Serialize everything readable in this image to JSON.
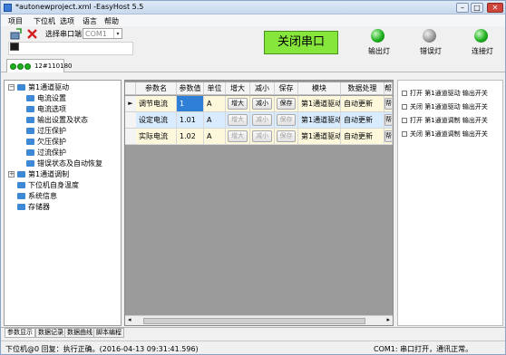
{
  "window": {
    "title": "*autonewproject.xml -EasyHost 5.5"
  },
  "menu": [
    "项目",
    "下位机",
    "选项",
    "语言",
    "帮助"
  ],
  "toolbar": {
    "port_label": "选择串口端口",
    "port_value": "COM1",
    "main_button": "关闭串口"
  },
  "lamps": [
    {
      "label": "输出灯",
      "color": "green"
    },
    {
      "label": "错误灯",
      "color": "gray"
    },
    {
      "label": "连接灯",
      "color": "green"
    }
  ],
  "device_tab": {
    "label": "12#110180"
  },
  "tree": [
    {
      "label": "第1通道驱动",
      "level": 0,
      "expanded": true
    },
    {
      "label": "电流设置",
      "level": 1
    },
    {
      "label": "电流选项",
      "level": 1
    },
    {
      "label": "输出设置及状态",
      "level": 1
    },
    {
      "label": "过压保护",
      "level": 1
    },
    {
      "label": "欠压保护",
      "level": 1
    },
    {
      "label": "过流保护",
      "level": 1
    },
    {
      "label": "错误状态及自动恢复",
      "level": 1
    },
    {
      "label": "第1通道调制",
      "level": 0,
      "expanded": false
    },
    {
      "label": "下位机自身温度",
      "level": 0
    },
    {
      "label": "系统信息",
      "level": 0
    },
    {
      "label": "存储器",
      "level": 0
    }
  ],
  "table": {
    "columns": [
      "参数名",
      "参数值",
      "单位",
      "增大",
      "减小",
      "保存",
      "模块",
      "数据处理",
      "帮"
    ],
    "rows": [
      {
        "name": "调节电流",
        "value": "1",
        "unit": "A",
        "inc": "增大",
        "dec": "减小",
        "save": "保存",
        "module": "第1通道驱动",
        "proc": "自动更新",
        "help": "帮",
        "enabled": true
      },
      {
        "name": "设定电流",
        "value": "1.01",
        "unit": "A",
        "inc": "增大",
        "dec": "减小",
        "save": "保存",
        "module": "第1通道驱动",
        "proc": "自动更新",
        "help": "帮",
        "enabled": false
      },
      {
        "name": "实际电流",
        "value": "1.02",
        "unit": "A",
        "inc": "增大",
        "dec": "减小",
        "save": "保存",
        "module": "第1通道驱动",
        "proc": "自动更新",
        "help": "帮",
        "enabled": false
      }
    ]
  },
  "right_list": [
    "打开 第1通道驱动 输出开关",
    "关闭 第1通道驱动 输出开关",
    "打开 第1通道调制 输出开关",
    "关闭 第1通道调制 输出开关"
  ],
  "bottom_tabs": [
    "参数显示",
    "数据记录",
    "数据曲线",
    "脚本编程"
  ],
  "status": {
    "left": "下位机@0 回复：执行正确。(2016-04-13 09:31:41.596)",
    "right": "COM1: 串口打开，通讯正常。"
  },
  "colors": {
    "accent_green": "#86e63c",
    "lamp_green": "#1fb01f",
    "selected_row": "#d9ecff",
    "value_highlight": "#2f7fd6"
  }
}
